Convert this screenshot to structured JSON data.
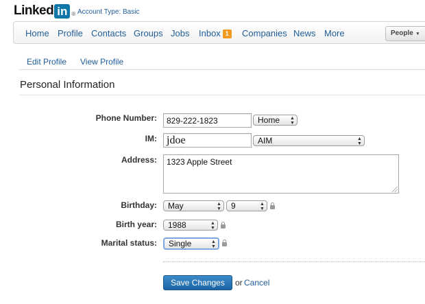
{
  "header": {
    "logo_word": "Linked",
    "logo_in": "in",
    "logo_reg": "®",
    "account_type": "Account Type: Basic"
  },
  "nav": {
    "items": [
      "Home",
      "Profile",
      "Contacts",
      "Groups",
      "Jobs",
      "Inbox",
      "Companies",
      "News",
      "More"
    ],
    "inbox_badge": "1",
    "people_label": "People",
    "people_caret": "▾"
  },
  "subtabs": {
    "edit": "Edit Profile",
    "view": "View Profile"
  },
  "section": {
    "title": "Personal Information"
  },
  "form": {
    "phone_label": "Phone Number:",
    "phone_value": "829-222-1823",
    "phone_type": "Home",
    "im_label": "IM:",
    "im_value": "jdoe",
    "im_type": "AIM",
    "address_label": "Address:",
    "address_value": "1323 Apple Street",
    "birthday_label": "Birthday:",
    "birthday_month": "May",
    "birthday_day": "9",
    "birth_year_label": "Birth year:",
    "birth_year": "1988",
    "marital_label": "Marital status:",
    "marital_value": "Single"
  },
  "actions": {
    "save": "Save Changes",
    "or": "or",
    "cancel": "Cancel"
  },
  "colors": {
    "link": "#1f5c99",
    "brand": "#0e76a8",
    "badge": "#f29a1f",
    "button": "#1a64a3"
  }
}
